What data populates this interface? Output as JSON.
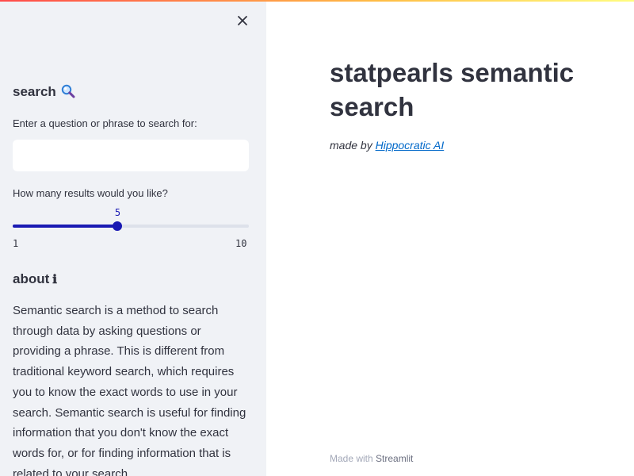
{
  "sidebar": {
    "search_heading": "search",
    "search_icon": "magnifying-glass-icon",
    "question_label": "Enter a question or phrase to search for:",
    "question_value": "",
    "results_label": "How many results would you like?",
    "slider": {
      "min": "1",
      "max": "10",
      "value": 5,
      "value_text": "5"
    },
    "about_heading": "about",
    "about_icon": "info-icon",
    "about_text": "Semantic search is a method to search through data by asking questions or providing a phrase. This is different from traditional keyword search, which requires you to know the exact words to use in your search. Semantic search is useful for finding information that you don't know the exact words for, or for finding information that is related to your search."
  },
  "main": {
    "title": "statpearls semantic search",
    "made_by_prefix": "made by ",
    "made_by_link": "Hippocratic AI",
    "footer_prefix": "Made with ",
    "footer_brand": "Streamlit"
  },
  "colors": {
    "accent": "#1a1ab3",
    "sidebar_bg": "#f0f2f6",
    "link": "#0068c9",
    "text": "#31333f"
  }
}
